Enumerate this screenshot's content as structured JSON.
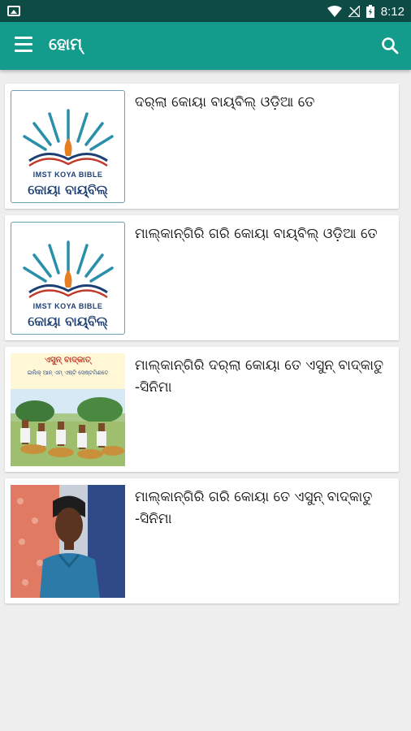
{
  "status_bar": {
    "time": "8:12"
  },
  "app_bar": {
    "title": "ହୋମ୍"
  },
  "items": [
    {
      "title": "ଦର୍‌ଲା କୋୟା ବାୟ୍‌ବିଲ୍ ଓଡ଼ିଆ ତେ",
      "thumb_caption_en": "IMST KOYA BIBLE",
      "thumb_caption_or": "କୋୟା ବାୟ୍‌ବିଲ୍"
    },
    {
      "title": "ମାଲ୍‌କାନ୍‌ଗିରି ଗରି କୋୟା ବାୟ୍‌ବିଲ୍ ଓଡ଼ିଆ ତେ",
      "thumb_caption_en": "IMST KOYA BIBLE",
      "thumb_caption_or": "କୋୟା ବାୟ୍‌ବିଲ୍"
    },
    {
      "title": "ମାଲ୍‌କାନ୍‌ଗିରି ଦର୍‌ଲା କୋୟା ତେ ଏସୁନ୍ ବାଦ୍‌କାତୁ -ସିନିମା",
      "thumb_caption_title": "ଏସୁନ୍ ବାଦ୍‌କାତ୍",
      "thumb_caption_sub": "ଇଲିକ୍ ଆନ୍ ଏମ୍ ଏଷ୍ଟି ସେଷ୍ଟମିଣତେ"
    },
    {
      "title": "ମାଲ୍‌କାନ୍‌ଗିରି ଗରି କୋୟା ତେ ଏସୁନ୍ ବାଦ୍‌କାତୁ -ସିନିମା"
    }
  ],
  "colors": {
    "status_bar": "#0d4b44",
    "app_bar": "#139b8c",
    "background": "#eeeeee",
    "card": "#ffffff"
  }
}
